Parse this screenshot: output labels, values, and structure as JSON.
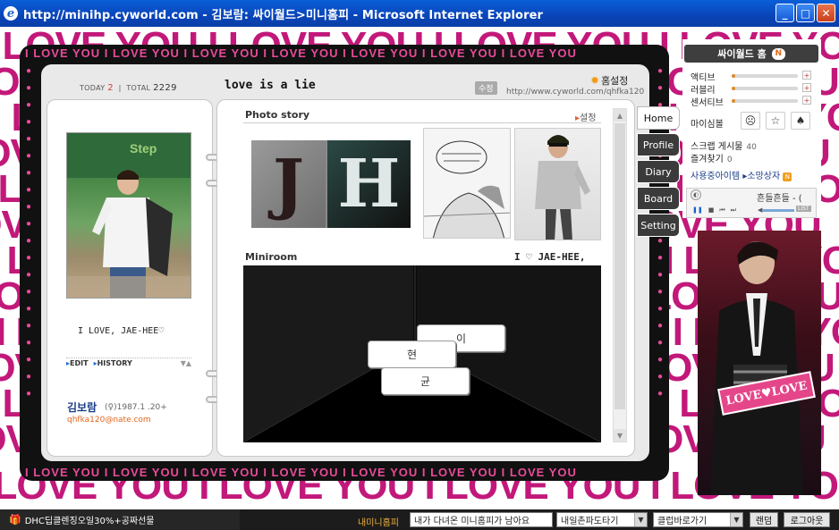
{
  "window": {
    "title": "http://minihp.cyworld.com - 김보람: 싸이월드>미니홈피 - Microsoft Internet Explorer",
    "buttons": {
      "minimize": "_",
      "maximize": "□",
      "close": "✕"
    }
  },
  "background": {
    "pattern_text": "I LOVE YOU I LOVE YOU I LOVE YOU I LOVE YOU",
    "ring_text": "I LOVE YOU I LOVE YOU I LOVE YOU I LOVE YOU I LOVE YOU I LOVE YOU I LOVE YOU",
    "accent": "#c2187a"
  },
  "header": {
    "today_label": "TODAY",
    "today_value": "2",
    "total_label": "TOTAL",
    "total_value": "2229",
    "title": "love is a lie",
    "edit_label": "수정",
    "home_setting": "홈설정",
    "url": "http://www.cyworld.com/qhfka120"
  },
  "profile": {
    "message": "I LOVE, JAE-HEE♡",
    "edit_link": "EDIT",
    "history_link": "HISTORY",
    "name": "김보람",
    "info": "(♀)1987.1 .20+",
    "email": "qhfka120@nate.com"
  },
  "main": {
    "photo_story_title": "Photo story",
    "setting_link": "설정",
    "photo_letters": [
      "J",
      "H"
    ],
    "miniroom_title": "Miniroom",
    "miniroom_caption": "I ♡ JAE-HEE,",
    "bubbles": [
      "이",
      "현",
      "균"
    ]
  },
  "tabs": [
    {
      "label": "Home",
      "active": true
    },
    {
      "label": "Profile",
      "active": false
    },
    {
      "label": "Diary",
      "active": false
    },
    {
      "label": "Board",
      "active": false
    },
    {
      "label": "Setting",
      "active": false
    }
  ],
  "sidebar": {
    "home_label": "싸이월드 홈",
    "home_badge": "N",
    "stats": [
      {
        "label": "액티브",
        "level": 0.05
      },
      {
        "label": "러블리",
        "level": 0.05
      },
      {
        "label": "센서티브",
        "level": 0.05
      }
    ],
    "mood_label": "마이심볼",
    "scrap_label": "스크랩 게시물",
    "scrap_count": "40",
    "favorites_label": "즐겨찾기",
    "favorites_count": "0",
    "items_label": "사용중아이템 ▸소망상자",
    "items_badge": "N",
    "player_title": "흔들흔들 - (",
    "player_list": "LIST",
    "photo_banner": "LOVE♥LOVE"
  },
  "statusbar": {
    "promo": "DHC딥클렌징오일30%+공짜선물",
    "my_minihp": "내미니홈피",
    "visited_msg": "내가 다녀온 미니홈피가 남아요",
    "select1": "내일촌파도타기",
    "select2": "클럽바로가기",
    "random_button": "랜덤",
    "logout_button": "로그아웃"
  }
}
